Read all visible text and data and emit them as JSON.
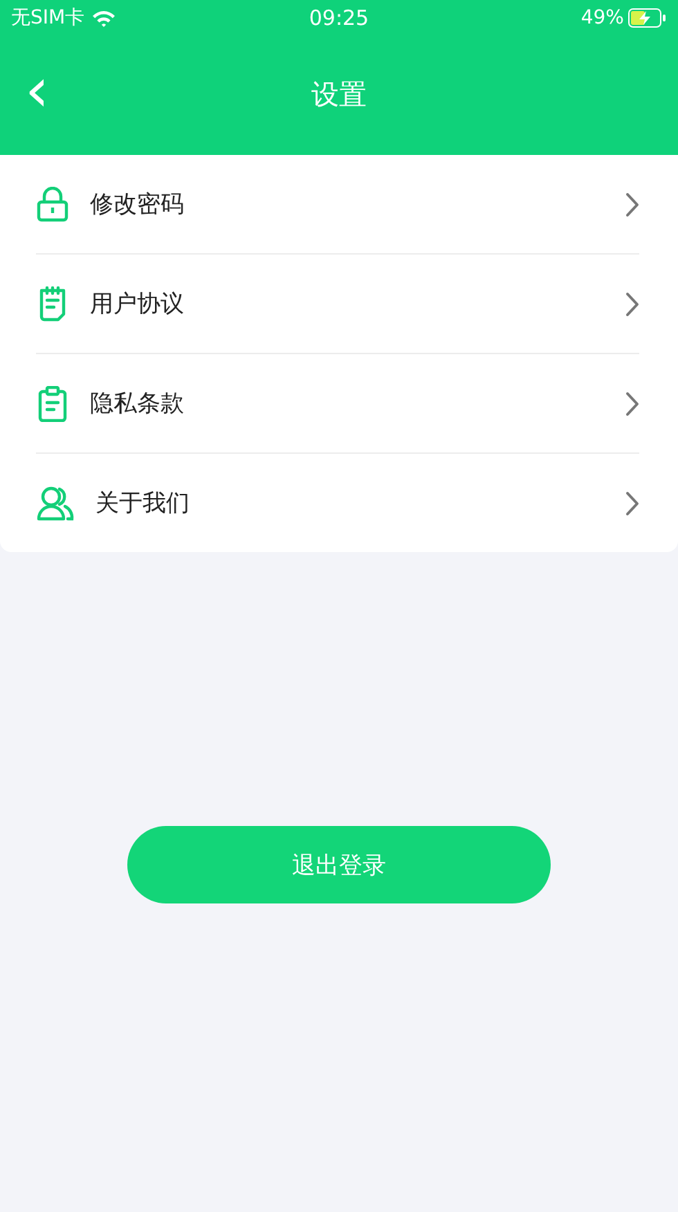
{
  "status_bar": {
    "carrier": "无SIM卡",
    "time": "09:25",
    "battery": "49%"
  },
  "header": {
    "back": "‹",
    "title": "设置"
  },
  "menu": [
    {
      "kind": "lock",
      "label": "修改密码"
    },
    {
      "kind": "notepad",
      "label": "用户协议"
    },
    {
      "kind": "clipboard",
      "label": "隐私条款"
    },
    {
      "kind": "people",
      "label": "关于我们"
    }
  ],
  "logout_button": "退出登录"
}
